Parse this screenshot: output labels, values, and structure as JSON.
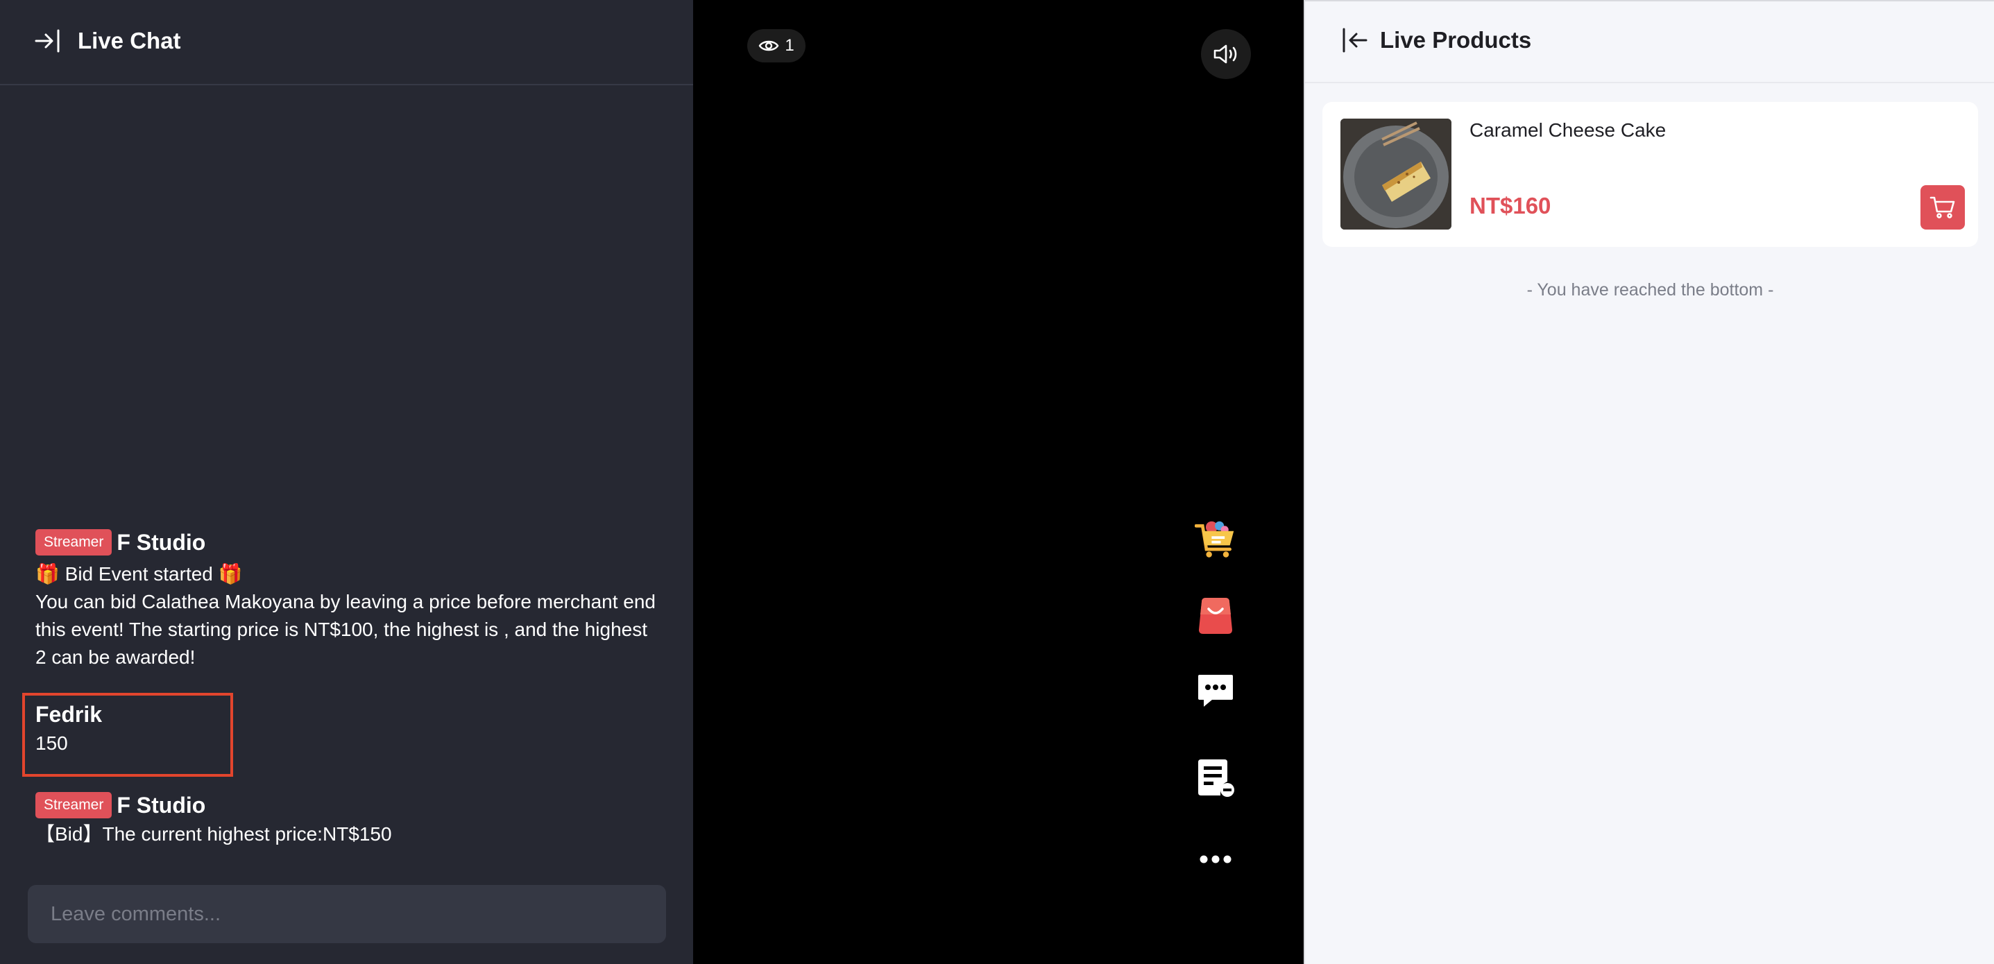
{
  "chat": {
    "title": "Live Chat",
    "messages": [
      {
        "badge": "Streamer",
        "author": "F Studio",
        "line1": "🎁 Bid Event started 🎁",
        "line2": "You can bid Calathea Makoyana by leaving a price before merchant end this event! The starting price is NT$100, the highest is , and the highest 2 can be awarded!"
      },
      {
        "author": "Fedrik",
        "text": "150"
      },
      {
        "badge": "Streamer",
        "author": "F Studio",
        "text": "【Bid】The current highest price:NT$150"
      }
    ],
    "comment_placeholder": "Leave comments..."
  },
  "video": {
    "viewer_count": "1",
    "side_icons": [
      "cart-icon",
      "shopping-bag-icon",
      "chat-bubble-icon",
      "order-list-icon",
      "more-icon"
    ]
  },
  "products": {
    "title": "Live Products",
    "items": [
      {
        "name": "Caramel Cheese Cake",
        "price": "NT$160"
      }
    ],
    "bottom_note": "- You have reached the bottom -"
  },
  "colors": {
    "accent": "#e05159",
    "highlight_box": "#e2452d",
    "chat_bg": "#262832",
    "products_bg": "#f5f6fa"
  }
}
